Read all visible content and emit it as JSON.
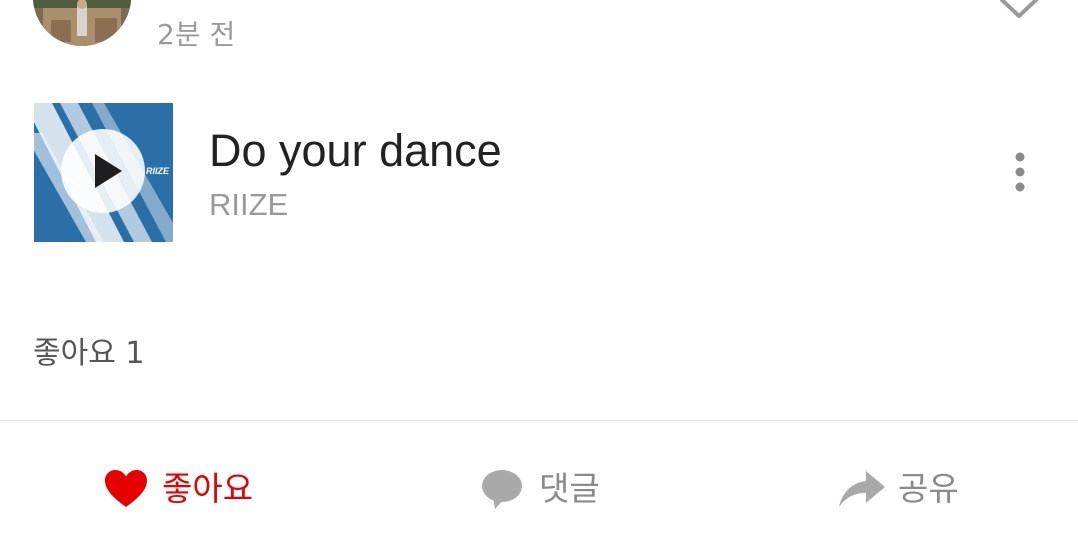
{
  "post": {
    "time_ago": "2분 전"
  },
  "song": {
    "title": "Do your dance",
    "artist": "RIIZE",
    "album_logo_text": "RIIZE"
  },
  "likes": {
    "summary": "좋아요 1"
  },
  "actions": {
    "like_label": "좋아요",
    "comment_label": "댓글",
    "share_label": "공유"
  },
  "colors": {
    "like_active": "#e60000",
    "secondary_text": "#8a8a8a",
    "album_sky": "#2b6fa9"
  },
  "icons": {
    "avatar": "profile-photo",
    "collapse": "chevron-down-icon",
    "play": "play-icon",
    "more": "more-vertical-icon",
    "like": "heart-icon",
    "comment": "speech-bubble-icon",
    "share": "share-arrow-icon"
  }
}
